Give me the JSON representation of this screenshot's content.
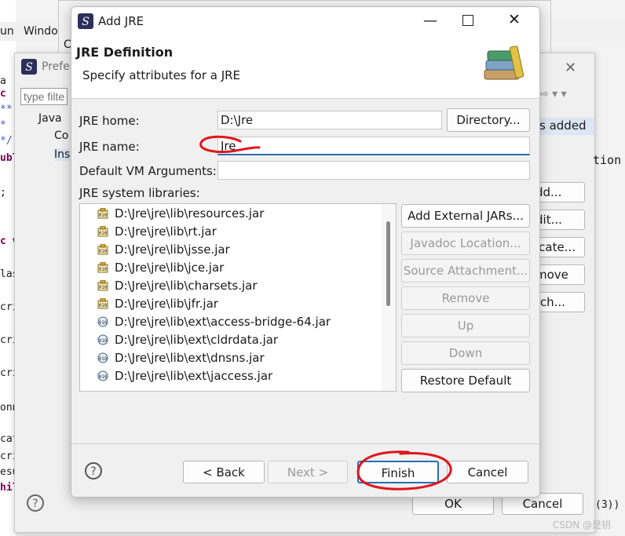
{
  "ide": {
    "menu": [
      "un",
      "Windo"
    ],
    "code_lines": [
      "a",
      "c",
      "**",
      "*",
      "*/",
      "ubl",
      ";",
      "c v",
      "las",
      "cri",
      "cri",
      "cri",
      "onn",
      "cat",
      "cri",
      "esu",
      "hil",
      "(3))"
    ]
  },
  "back_window": {
    "label": "C"
  },
  "preferences": {
    "title": "Prefer",
    "filter_placeholder": "type filte",
    "tree": [
      "Java",
      "Co",
      "Ins"
    ],
    "info_text": "s added",
    "info_text2": "tion",
    "side_buttons": [
      "dd...",
      "dit...",
      "icate...",
      "move",
      "rch..."
    ],
    "ok_label": "OK",
    "cancel_label": "Cancel"
  },
  "dialog": {
    "title": "Add JRE",
    "header_title": "JRE Definition",
    "header_desc": "Specify attributes for a JRE",
    "jre_home_label": "JRE home:",
    "jre_home_value": "D:\\Jre",
    "directory_button": "Directory...",
    "jre_name_label": "JRE name:",
    "jre_name_value": "Jre",
    "vm_args_label": "Default VM Arguments:",
    "vm_args_value": "",
    "libraries_label": "JRE system libraries:",
    "libraries": [
      "D:\\Jre\\jre\\lib\\resources.jar",
      "D:\\Jre\\jre\\lib\\rt.jar",
      "D:\\Jre\\jre\\lib\\jsse.jar",
      "D:\\Jre\\jre\\lib\\jce.jar",
      "D:\\Jre\\jre\\lib\\charsets.jar",
      "D:\\Jre\\jre\\lib\\jfr.jar",
      "D:\\Jre\\jre\\lib\\ext\\access-bridge-64.jar",
      "D:\\Jre\\jre\\lib\\ext\\cldrdata.jar",
      "D:\\Jre\\jre\\lib\\ext\\dnsns.jar",
      "D:\\Jre\\jre\\lib\\ext\\jaccess.jar"
    ],
    "side_buttons": {
      "add_external": "Add External JARs...",
      "javadoc": "Javadoc Location...",
      "source": "Source Attachment...",
      "remove": "Remove",
      "up": "Up",
      "down": "Down",
      "restore": "Restore Default"
    },
    "footer": {
      "back": "< Back",
      "next": "Next >",
      "finish": "Finish",
      "cancel": "Cancel"
    }
  },
  "watermark": "CSDN @是钥"
}
